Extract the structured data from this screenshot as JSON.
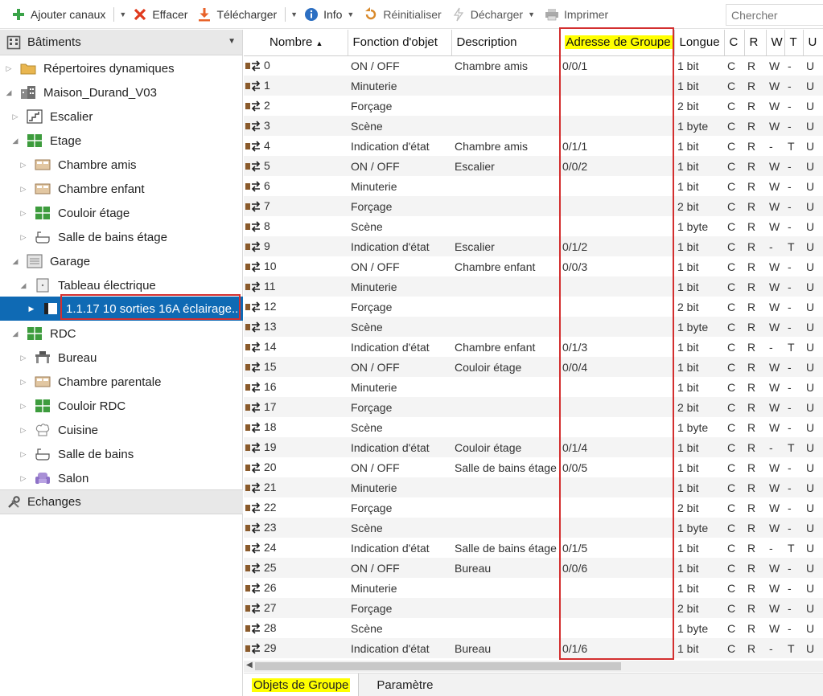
{
  "toolbar": {
    "add_channels": "Ajouter canaux",
    "delete": "Effacer",
    "upload": "Télécharger",
    "info": "Info",
    "reset": "Réinitialiser",
    "unload": "Décharger",
    "print": "Imprimer",
    "search_placeholder": "Chercher"
  },
  "left_panel": {
    "header": "Bâtiments",
    "tree": [
      {
        "label": "Répertoires dynamiques"
      },
      {
        "label": "Maison_Durand_V03"
      },
      {
        "label": "Escalier"
      },
      {
        "label": "Etage"
      },
      {
        "label": "Chambre amis"
      },
      {
        "label": "Chambre enfant"
      },
      {
        "label": "Couloir étage"
      },
      {
        "label": "Salle de bains étage"
      },
      {
        "label": "Garage"
      },
      {
        "label": "Tableau électrique"
      },
      {
        "label": "1.1.17 10 sorties 16A éclairage..."
      },
      {
        "label": "RDC"
      },
      {
        "label": "Bureau"
      },
      {
        "label": "Chambre parentale"
      },
      {
        "label": "Couloir RDC"
      },
      {
        "label": "Cuisine"
      },
      {
        "label": "Salle de bains"
      },
      {
        "label": "Salon"
      }
    ],
    "exchanges": "Echanges"
  },
  "table": {
    "columns": [
      "Nombre",
      "Fonction d'objet",
      "Description",
      "Adresse de Groupe",
      "Longue",
      "C",
      "R",
      "W",
      "T",
      "U"
    ],
    "rows": [
      [
        "0",
        "ON / OFF",
        "Chambre amis",
        "0/0/1",
        "1 bit",
        "C",
        "R",
        "W",
        "-",
        "U"
      ],
      [
        "1",
        "Minuterie",
        "",
        "",
        "1 bit",
        "C",
        "R",
        "W",
        "-",
        "U"
      ],
      [
        "2",
        "Forçage",
        "",
        "",
        "2 bit",
        "C",
        "R",
        "W",
        "-",
        "U"
      ],
      [
        "3",
        "Scène",
        "",
        "",
        "1 byte",
        "C",
        "R",
        "W",
        "-",
        "U"
      ],
      [
        "4",
        "Indication d'état",
        "Chambre amis",
        "0/1/1",
        "1 bit",
        "C",
        "R",
        "-",
        "T",
        "U"
      ],
      [
        "5",
        "ON / OFF",
        "Escalier",
        "0/0/2",
        "1 bit",
        "C",
        "R",
        "W",
        "-",
        "U"
      ],
      [
        "6",
        "Minuterie",
        "",
        "",
        "1 bit",
        "C",
        "R",
        "W",
        "-",
        "U"
      ],
      [
        "7",
        "Forçage",
        "",
        "",
        "2 bit",
        "C",
        "R",
        "W",
        "-",
        "U"
      ],
      [
        "8",
        "Scène",
        "",
        "",
        "1 byte",
        "C",
        "R",
        "W",
        "-",
        "U"
      ],
      [
        "9",
        "Indication d'état",
        "Escalier",
        "0/1/2",
        "1 bit",
        "C",
        "R",
        "-",
        "T",
        "U"
      ],
      [
        "10",
        "ON / OFF",
        "Chambre enfant",
        "0/0/3",
        "1 bit",
        "C",
        "R",
        "W",
        "-",
        "U"
      ],
      [
        "11",
        "Minuterie",
        "",
        "",
        "1 bit",
        "C",
        "R",
        "W",
        "-",
        "U"
      ],
      [
        "12",
        "Forçage",
        "",
        "",
        "2 bit",
        "C",
        "R",
        "W",
        "-",
        "U"
      ],
      [
        "13",
        "Scène",
        "",
        "",
        "1 byte",
        "C",
        "R",
        "W",
        "-",
        "U"
      ],
      [
        "14",
        "Indication d'état",
        "Chambre enfant",
        "0/1/3",
        "1 bit",
        "C",
        "R",
        "-",
        "T",
        "U"
      ],
      [
        "15",
        "ON / OFF",
        "Couloir étage",
        "0/0/4",
        "1 bit",
        "C",
        "R",
        "W",
        "-",
        "U"
      ],
      [
        "16",
        "Minuterie",
        "",
        "",
        "1 bit",
        "C",
        "R",
        "W",
        "-",
        "U"
      ],
      [
        "17",
        "Forçage",
        "",
        "",
        "2 bit",
        "C",
        "R",
        "W",
        "-",
        "U"
      ],
      [
        "18",
        "Scène",
        "",
        "",
        "1 byte",
        "C",
        "R",
        "W",
        "-",
        "U"
      ],
      [
        "19",
        "Indication d'état",
        "Couloir étage",
        "0/1/4",
        "1 bit",
        "C",
        "R",
        "-",
        "T",
        "U"
      ],
      [
        "20",
        "ON / OFF",
        "Salle de bains étage",
        "0/0/5",
        "1 bit",
        "C",
        "R",
        "W",
        "-",
        "U"
      ],
      [
        "21",
        "Minuterie",
        "",
        "",
        "1 bit",
        "C",
        "R",
        "W",
        "-",
        "U"
      ],
      [
        "22",
        "Forçage",
        "",
        "",
        "2 bit",
        "C",
        "R",
        "W",
        "-",
        "U"
      ],
      [
        "23",
        "Scène",
        "",
        "",
        "1 byte",
        "C",
        "R",
        "W",
        "-",
        "U"
      ],
      [
        "24",
        "Indication d'état",
        "Salle de bains étage",
        "0/1/5",
        "1 bit",
        "C",
        "R",
        "-",
        "T",
        "U"
      ],
      [
        "25",
        "ON / OFF",
        "Bureau",
        "0/0/6",
        "1 bit",
        "C",
        "R",
        "W",
        "-",
        "U"
      ],
      [
        "26",
        "Minuterie",
        "",
        "",
        "1 bit",
        "C",
        "R",
        "W",
        "-",
        "U"
      ],
      [
        "27",
        "Forçage",
        "",
        "",
        "2 bit",
        "C",
        "R",
        "W",
        "-",
        "U"
      ],
      [
        "28",
        "Scène",
        "",
        "",
        "1 byte",
        "C",
        "R",
        "W",
        "-",
        "U"
      ],
      [
        "29",
        "Indication d'état",
        "Bureau",
        "0/1/6",
        "1 bit",
        "C",
        "R",
        "-",
        "T",
        "U"
      ]
    ]
  },
  "bottom_tabs": {
    "group_objects": "Objets de Groupe",
    "parameter": "Paramètre"
  },
  "colors": {
    "selection": "#0f6ab4",
    "highlight": "#ffff00",
    "annotation_red": "#d32f2f"
  }
}
